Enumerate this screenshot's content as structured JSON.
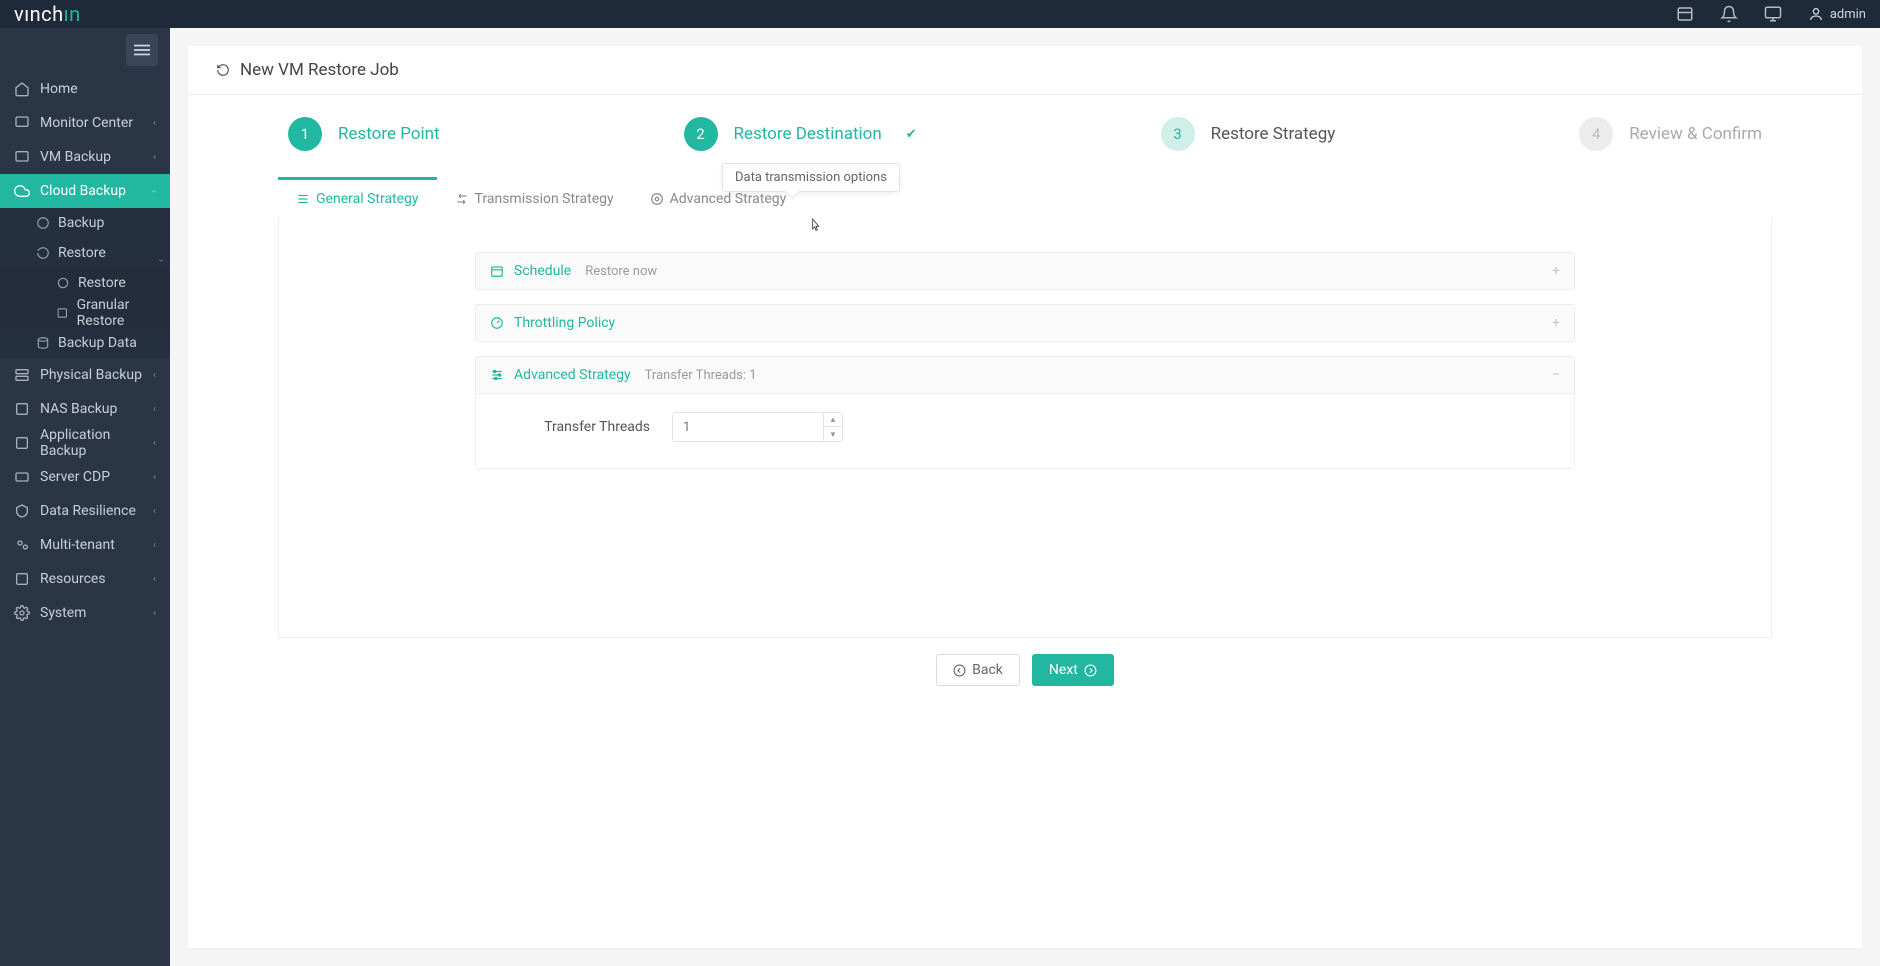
{
  "brand": {
    "part1": "vınch",
    "part2": "ın"
  },
  "user": {
    "name": "admin"
  },
  "page": {
    "title": "New VM Restore Job"
  },
  "sidebar": {
    "items": [
      {
        "label": "Home"
      },
      {
        "label": "Monitor Center"
      },
      {
        "label": "VM Backup"
      },
      {
        "label": "Cloud Backup"
      },
      {
        "label": "Physical Backup"
      },
      {
        "label": "NAS Backup"
      },
      {
        "label": "Application Backup"
      },
      {
        "label": "Server CDP"
      },
      {
        "label": "Data Resilience"
      },
      {
        "label": "Multi-tenant"
      },
      {
        "label": "Resources"
      },
      {
        "label": "System"
      }
    ],
    "cloud_sub": [
      {
        "label": "Backup"
      },
      {
        "label": "Restore"
      },
      {
        "label": "Backup Data"
      }
    ],
    "restore_sub": [
      {
        "label": "Restore"
      },
      {
        "label": "Granular Restore"
      }
    ]
  },
  "steps": [
    {
      "num": "1",
      "label": "Restore Point"
    },
    {
      "num": "2",
      "label": "Restore Destination"
    },
    {
      "num": "3",
      "label": "Restore Strategy"
    },
    {
      "num": "4",
      "label": "Review & Confirm"
    }
  ],
  "tabs": [
    {
      "label": "General Strategy"
    },
    {
      "label": "Transmission Strategy"
    },
    {
      "label": "Advanced Strategy"
    }
  ],
  "tooltip": "Data transmission options",
  "accordion": {
    "schedule": {
      "title": "Schedule",
      "sub": "Restore now"
    },
    "throttling": {
      "title": "Throttling Policy"
    },
    "advanced": {
      "title": "Advanced Strategy",
      "sub": "Transfer Threads: 1"
    }
  },
  "form": {
    "transfer_threads_label": "Transfer Threads",
    "transfer_threads_placeholder": "1"
  },
  "buttons": {
    "back": "Back",
    "next": "Next"
  }
}
